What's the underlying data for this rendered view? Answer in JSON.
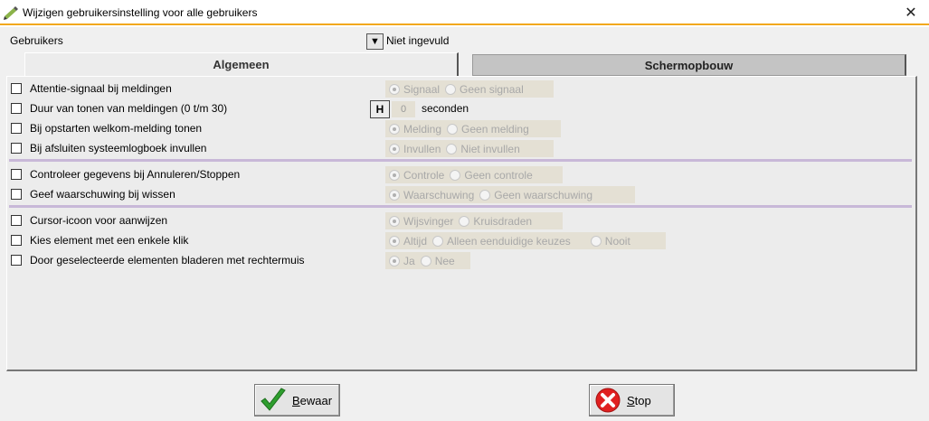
{
  "window": {
    "title": "Wijzigen gebruikersinstelling voor alle gebruikers",
    "close_glyph": "✕"
  },
  "users": {
    "label": "Gebruikers",
    "dropdown_glyph": "▼",
    "value": "Niet ingevuld"
  },
  "tabs": [
    {
      "label": "Algemeen",
      "active": true
    },
    {
      "label": "Schermopbouw",
      "active": false
    }
  ],
  "settings": [
    {
      "label": "Attentie-signaal bij meldingen",
      "options": [
        "Signaal",
        "Geen signaal"
      ],
      "selected": 0
    },
    {
      "label": "Duur van tonen van meldingen (0 t/m 30)",
      "button": "H",
      "value": "0",
      "unit": "seconden"
    },
    {
      "label": "Bij opstarten welkom-melding tonen",
      "options": [
        "Melding",
        "Geen melding"
      ],
      "selected": 0
    },
    {
      "label": "Bij afsluiten systeemlogboek invullen",
      "options": [
        "Invullen",
        "Niet invullen"
      ],
      "selected": 0
    },
    {
      "label": "Controleer gegevens bij Annuleren/Stoppen",
      "options": [
        "Controle",
        "Geen controle"
      ],
      "selected": 0
    },
    {
      "label": "Geef waarschuwing bij wissen",
      "options": [
        "Waarschuwing",
        "Geen waarschuwing"
      ],
      "selected": 0
    },
    {
      "label": "Cursor-icoon voor aanwijzen",
      "options": [
        "Wijsvinger",
        "Kruisdraden"
      ],
      "selected": 0
    },
    {
      "label": "Kies element met een enkele klik",
      "options": [
        "Altijd",
        "Alleen eenduidige keuzes",
        "Nooit"
      ],
      "selected": 0
    },
    {
      "label": "Door geselecteerde elementen bladeren met rechtermuis",
      "options": [
        "Ja",
        "Nee"
      ],
      "selected": 0
    }
  ],
  "buttons": {
    "save": {
      "mnemonic": "B",
      "rest": "ewaar"
    },
    "stop": {
      "mnemonic": "S",
      "rest": "top"
    }
  },
  "colors": {
    "accent": "#f2a81d",
    "save_check": "#2e9e2e",
    "stop_icon": "#e02020",
    "separator": "#c8b8d8"
  }
}
